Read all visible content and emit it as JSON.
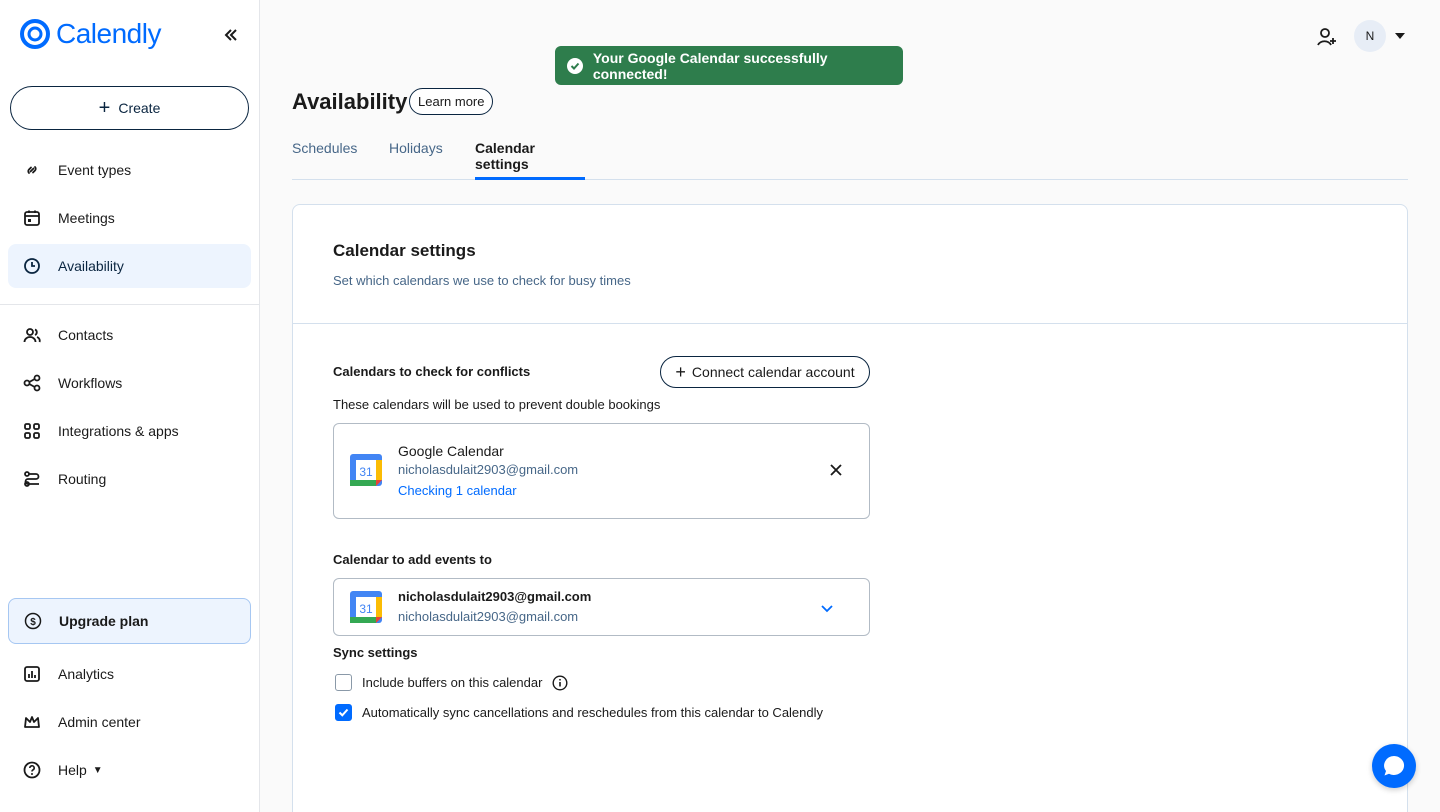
{
  "app": {
    "name": "Calendly"
  },
  "sidebar": {
    "create_label": "Create",
    "items": [
      {
        "label": "Event types",
        "icon": "link-icon"
      },
      {
        "label": "Meetings",
        "icon": "calendar-icon"
      },
      {
        "label": "Availability",
        "icon": "clock-icon",
        "active": true
      },
      {
        "label": "Contacts",
        "icon": "people-icon"
      },
      {
        "label": "Workflows",
        "icon": "workflow-icon"
      },
      {
        "label": "Integrations & apps",
        "icon": "grid-icon"
      },
      {
        "label": "Routing",
        "icon": "routing-icon"
      }
    ],
    "upgrade_label": "Upgrade plan",
    "bottom_items": [
      {
        "label": "Analytics",
        "icon": "chart-icon"
      },
      {
        "label": "Admin center",
        "icon": "crown-icon"
      },
      {
        "label": "Help",
        "icon": "help-icon"
      }
    ]
  },
  "topbar": {
    "avatar_initial": "N"
  },
  "toast": {
    "message": "Your Google Calendar successfully connected!"
  },
  "header": {
    "title": "Availability",
    "learn_more": "Learn more",
    "tabs": [
      {
        "label": "Schedules"
      },
      {
        "label": "Holidays"
      },
      {
        "label": "Calendar settings",
        "active": true
      }
    ]
  },
  "calendar_settings": {
    "title": "Calendar settings",
    "subtitle": "Set which calendars we use to check for busy times",
    "conflicts": {
      "label": "Calendars to check for conflicts",
      "connect_button": "Connect calendar account",
      "description": "These calendars will be used to prevent double bookings",
      "account": {
        "provider": "Google Calendar",
        "email": "nicholasdulait2903@gmail.com",
        "status": "Checking 1 calendar",
        "icon_day": "31"
      }
    },
    "add_events": {
      "label": "Calendar to add events to",
      "selected_title": "nicholasdulait2903@gmail.com",
      "selected_email": "nicholasdulait2903@gmail.com",
      "icon_day": "31"
    },
    "sync": {
      "label": "Sync settings",
      "options": [
        {
          "label": "Include buffers on this calendar",
          "checked": false
        },
        {
          "label": "Automatically sync cancellations and reschedules from this calendar to Calendly",
          "checked": true
        }
      ]
    }
  },
  "colors": {
    "accent": "#006bff",
    "toast_bg": "#2e7d4c",
    "nav_active_bg": "#edf4fe"
  }
}
